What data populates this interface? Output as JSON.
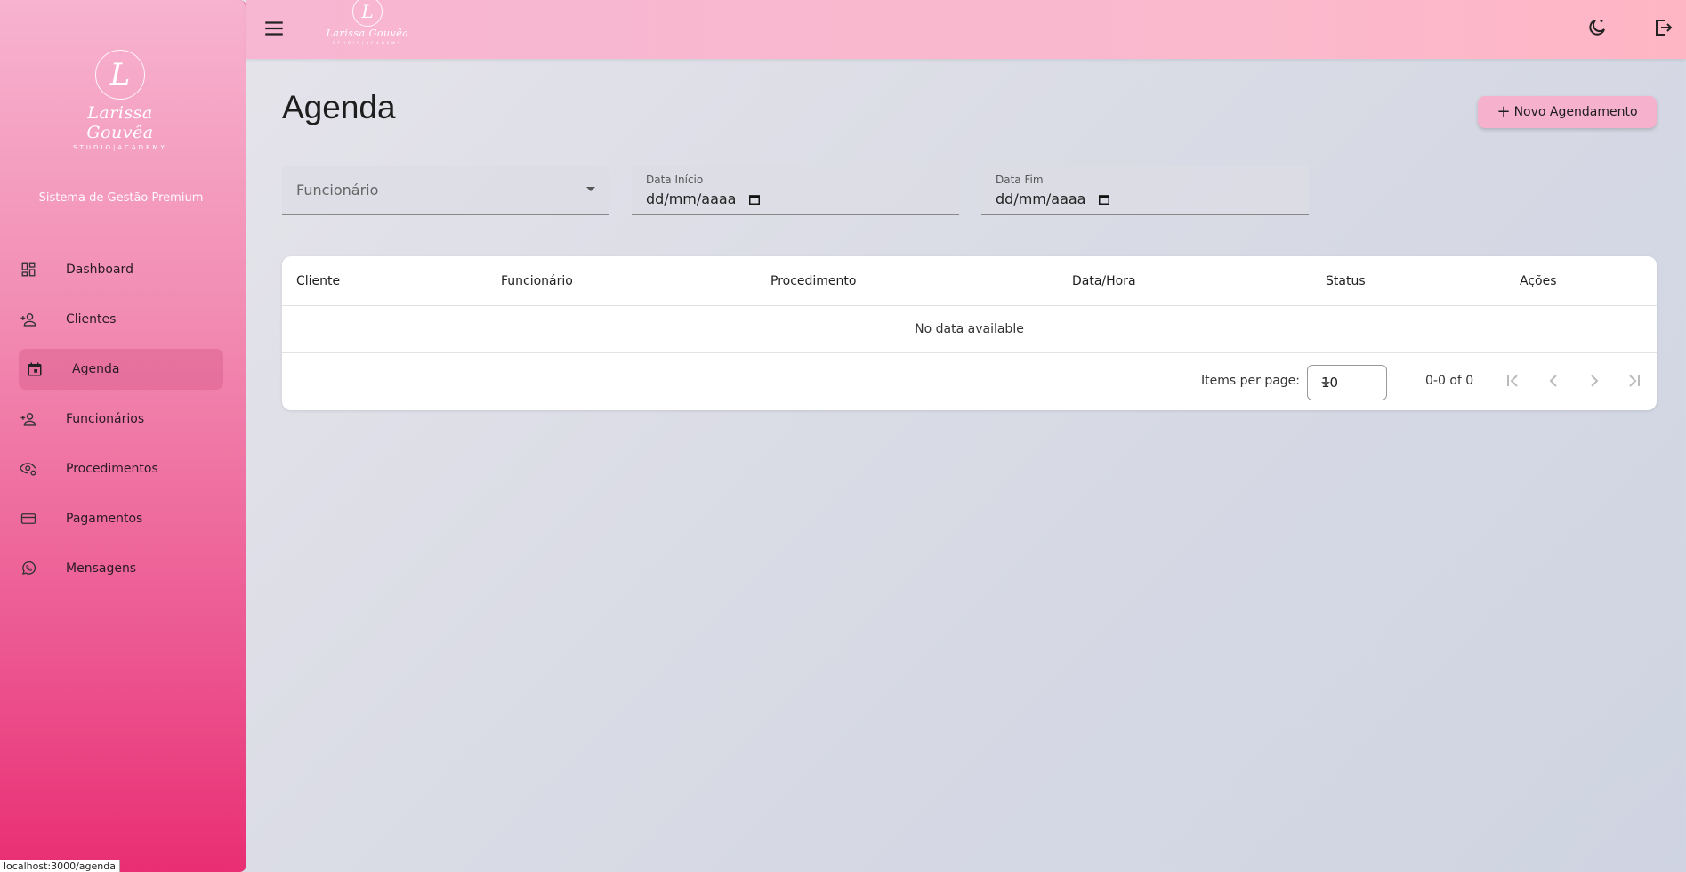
{
  "sidebar": {
    "logo": {
      "mark": "L",
      "name": "Larissa Gouvêa",
      "sub": "STUDIO|ACADEMY"
    },
    "subtitle": "Sistema de Gestão Premium",
    "items": [
      {
        "label": "Dashboard",
        "icon": "dashboard-icon"
      },
      {
        "label": "Clientes",
        "icon": "person-add-icon"
      },
      {
        "label": "Agenda",
        "icon": "calendar-icon",
        "active": true
      },
      {
        "label": "Funcionários",
        "icon": "person-add-icon"
      },
      {
        "label": "Procedimentos",
        "icon": "eye-settings-icon"
      },
      {
        "label": "Pagamentos",
        "icon": "credit-card-icon"
      },
      {
        "label": "Mensagens",
        "icon": "whatsapp-icon"
      }
    ]
  },
  "topbar": {
    "logo": {
      "mark": "L",
      "name": "Larissa Gouvêa",
      "sub": "STUDIO|ACADEMY"
    },
    "icons": [
      "menu-icon",
      "dark-mode-icon",
      "logout-icon"
    ]
  },
  "main": {
    "title": "Agenda",
    "new_button": "Novo Agendamento",
    "filters": {
      "employee_placeholder": "Funcionário",
      "start_label": "Data Início",
      "start_value": "dd/mm/aaaa",
      "end_label": "Data Fim",
      "end_value": "dd/mm/aaaa"
    },
    "table": {
      "columns": [
        "Cliente",
        "Funcionário",
        "Procedimento",
        "Data/Hora",
        "Status",
        "Ações"
      ],
      "empty": "No data available",
      "items_per_page_label": "Items per page:",
      "items_per_page": "10",
      "range": "0-0 of 0"
    }
  },
  "statusbar": "localhost:3000/agenda",
  "colors": {
    "accent": "#ec5690",
    "sidebar_top": "#f7b3cf",
    "sidebar_bottom": "#e92e73",
    "button": "#f6b2cc"
  }
}
